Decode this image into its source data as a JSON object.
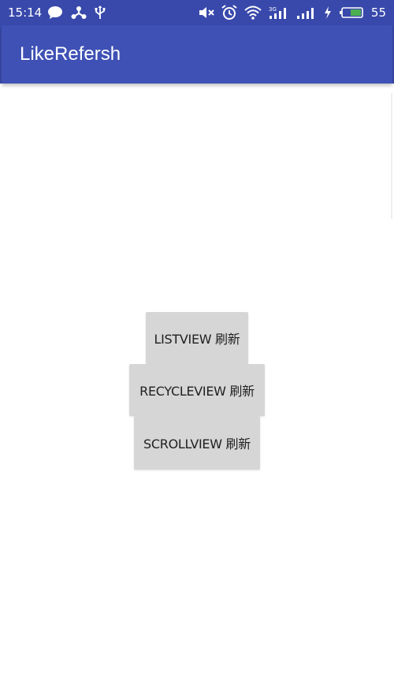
{
  "status_bar": {
    "time": "15:14",
    "battery_percent": "55",
    "background": "#3949ab",
    "icons_left": [
      "chat-bubble-icon",
      "share-node-icon",
      "usb-icon"
    ],
    "icons_right": [
      "mute-icon",
      "alarm-icon",
      "wifi-icon",
      "signal-3g-icon",
      "signal-icon",
      "charging-icon",
      "battery-icon"
    ]
  },
  "app_bar": {
    "title": "LikeRefersh",
    "background": "#3f51b5"
  },
  "buttons": {
    "listview": "LISTVIEW 刷新",
    "recycleview": "RECYCLEVIEW 刷新",
    "scrollview": "SCROLLVIEW 刷新",
    "background": "#d6d6d6"
  }
}
